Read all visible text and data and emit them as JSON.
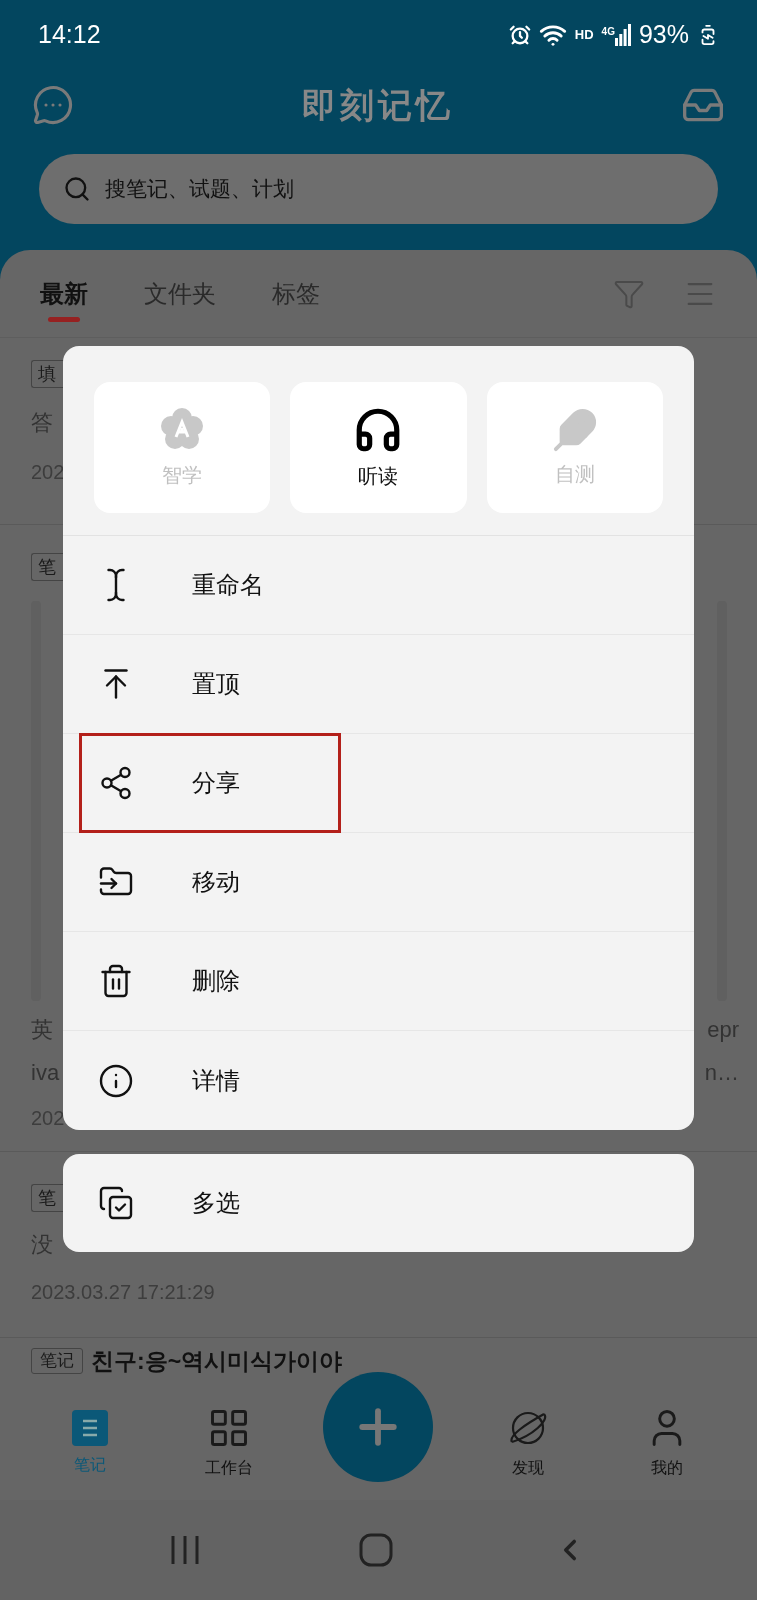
{
  "status_bar": {
    "time": "14:12",
    "hd": "HD",
    "network": "4G",
    "battery": "93%"
  },
  "header": {
    "title": "即刻记忆"
  },
  "search": {
    "placeholder": "搜笔记、试题、计划"
  },
  "tabs": [
    {
      "label": "最新",
      "selected": true
    },
    {
      "label": "文件夹",
      "selected": false
    },
    {
      "label": "标签",
      "selected": false
    }
  ],
  "list_fragments": [
    {
      "tag": "填",
      "lines": [
        "答"
      ],
      "date": "202"
    },
    {
      "tag": "笔",
      "lines": [
        "英",
        "iva"
      ],
      "right_lines": [
        "epr",
        "n…"
      ],
      "date": "202",
      "kind": "image"
    },
    {
      "tag": "笔",
      "lines": [
        "没"
      ],
      "date": "2023.03.27 17:21:29"
    },
    {
      "tag": "笔记",
      "title": "친구:응~역시미식가이야"
    }
  ],
  "menu": {
    "quick_actions": [
      {
        "label": "智学",
        "kind": "flower",
        "disabled": true
      },
      {
        "label": "听读",
        "kind": "headphones",
        "disabled": false
      },
      {
        "label": "自测",
        "kind": "feather",
        "disabled": true
      }
    ],
    "items": [
      {
        "label": "重命名",
        "kind": "rename",
        "highlighted": false
      },
      {
        "label": "置顶",
        "kind": "pin",
        "highlighted": false
      },
      {
        "label": "分享",
        "kind": "share",
        "highlighted": true
      },
      {
        "label": "移动",
        "kind": "move",
        "highlighted": false
      },
      {
        "label": "删除",
        "kind": "delete",
        "highlighted": false
      },
      {
        "label": "详情",
        "kind": "info",
        "highlighted": false
      }
    ],
    "extra": {
      "label": "多选",
      "kind": "multi"
    }
  },
  "bottom_nav": [
    {
      "label": "笔记",
      "kind": "notes",
      "selected": true
    },
    {
      "label": "工作台",
      "kind": "grid",
      "selected": false
    },
    {
      "kind": "add"
    },
    {
      "label": "发现",
      "kind": "planet",
      "selected": false
    },
    {
      "label": "我的",
      "kind": "user",
      "selected": false
    }
  ]
}
